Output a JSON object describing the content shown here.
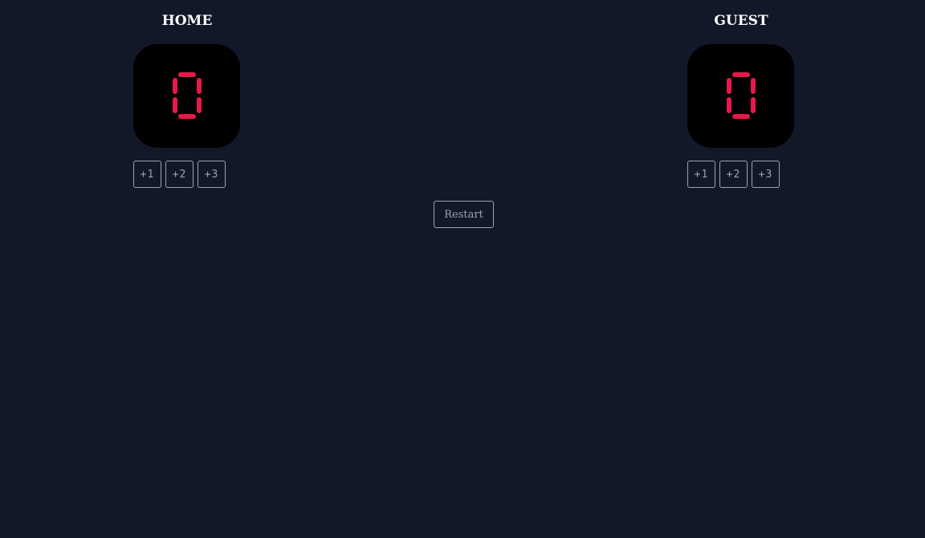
{
  "home": {
    "name": "HOME",
    "score": "0",
    "buttons": [
      "+1",
      "+2",
      "+3"
    ]
  },
  "guest": {
    "name": "GUEST",
    "score": "0",
    "buttons": [
      "+1",
      "+2",
      "+3"
    ]
  },
  "restart_label": "Restart",
  "colors": {
    "background": "#121828",
    "score_box": "#000000",
    "score_digit": "#e8194a",
    "button_border": "#9aa3b3",
    "team_name": "#ffffff"
  }
}
